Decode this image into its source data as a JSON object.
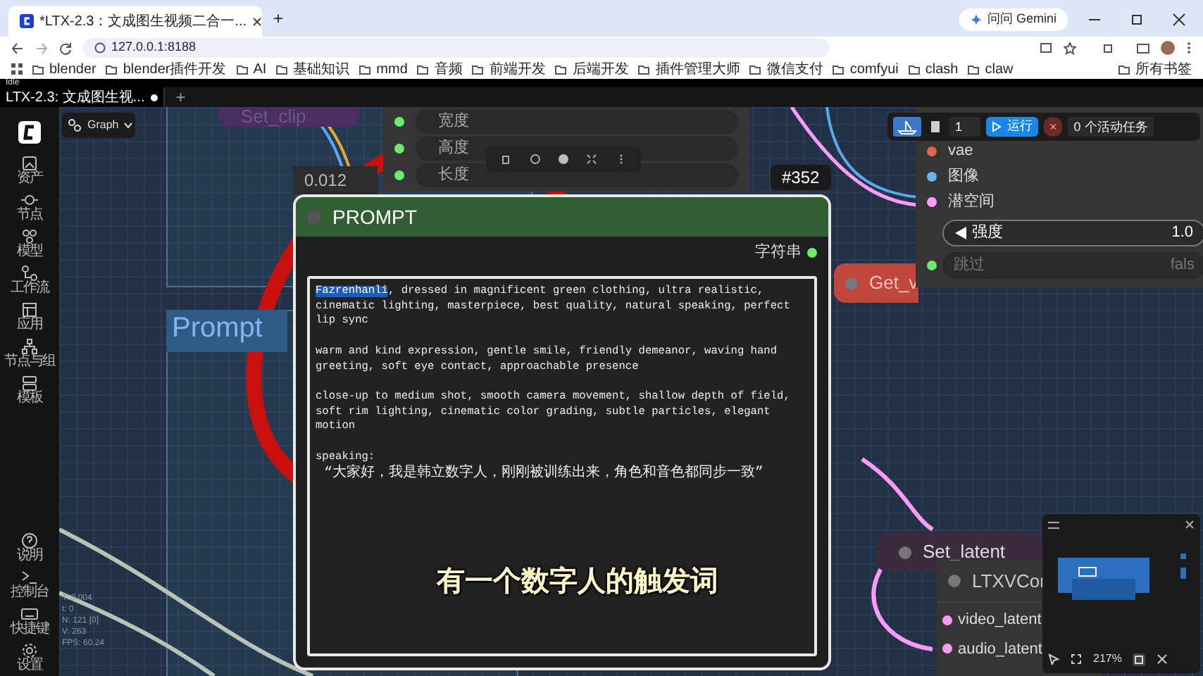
{
  "browser": {
    "tab_title": "*LTX-2.3：文成图生视频二合一...",
    "new_tab": "+",
    "gemini": "问问 Gemini",
    "address": "127.0.0.1:8188",
    "bookmarks": [
      "blender",
      "blender插件开发",
      "AI",
      "基础知识",
      "mmd",
      "音频",
      "前端开发",
      "后端开发",
      "插件管理大师",
      "微信支付",
      "comfyui",
      "clash",
      "claw"
    ],
    "all_bookmarks": "所有书签"
  },
  "status": "Idle",
  "app": {
    "workflow_tabs": [
      {
        "label": "LTX-2.3: 文成图生视...",
        "selected": true,
        "modified": true
      }
    ],
    "new_tab": "+",
    "graph_button": "Graph",
    "sidebar_top": [
      {
        "label": "资产",
        "kind": "assets"
      },
      {
        "label": "节点",
        "kind": "nodes"
      },
      {
        "label": "模型",
        "kind": "models"
      },
      {
        "label": "工作流",
        "kind": "workflow"
      },
      {
        "label": "应用",
        "kind": "apps"
      },
      {
        "label": "节点与组",
        "kind": "tree"
      },
      {
        "label": "模板",
        "kind": "templates"
      }
    ],
    "sidebar_bottom": [
      {
        "label": "说明",
        "kind": "help"
      },
      {
        "label": "控制台",
        "kind": "console"
      },
      {
        "label": "快捷键",
        "kind": "keyboard"
      },
      {
        "label": "设置",
        "kind": "settings"
      }
    ],
    "stats": [
      "T: 0.004",
      "t: 0",
      "N: 121 [0]",
      "V: 263",
      "FPS: 60.24"
    ]
  },
  "canvas": {
    "set_clip": "Set_clip",
    "size_widgets": [
      "宽度",
      "高度",
      "长度"
    ],
    "value_tag": "0.012",
    "group_label": "Prompt",
    "prompt_node": {
      "id": "#352",
      "title": "PROMPT",
      "output": "字符串",
      "selected_text": "Fazrenhanli",
      "text": ", dressed in magnificent green clothing, ultra realistic, cinematic lighting, masterpiece, best quality, natural speaking, perfect lip sync\n\nwarm and kind expression, gentle smile, friendly demeanor, waving hand greeting, soft eye contact, approachable presence\n\nclose-up to medium shot, smooth camera movement, shallow depth of field, soft rim lighting, cinematic color grading, subtle particles, elegant motion\n\nspeaking:",
      "speech": " “大家好，我是韩立数字人，刚刚被训练出来，角色和音色都同步一致”"
    },
    "get_node": "Get_v",
    "right_node": {
      "inputs": [
        {
          "label": "vae",
          "color": "#e2654f"
        },
        {
          "label": "图像",
          "color": "#64b5f6"
        },
        {
          "label": "潜空间",
          "color": "#ff9cf9"
        }
      ],
      "widgets": [
        {
          "label": "强度",
          "value": "1.0",
          "disabled": false
        },
        {
          "label": "跳过",
          "value": "fals",
          "disabled": true
        }
      ]
    },
    "run_toolbar": {
      "count": "1",
      "run": "运行",
      "cancel": "×",
      "tasks": "0 个活动任务"
    },
    "set_latent": "Set_latent",
    "ltxv_node": {
      "title": "LTXVCor",
      "inputs": [
        "video_latent",
        "audio_latent"
      ]
    },
    "minimap": {
      "zoom": "217%"
    },
    "caption": "有一个数字人的触发词"
  }
}
